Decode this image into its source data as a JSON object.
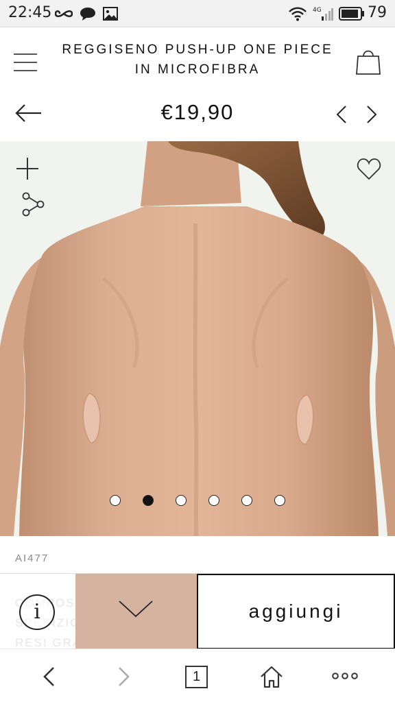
{
  "status_bar": {
    "time": "22:45",
    "battery": "79",
    "icons": [
      "infinity-icon",
      "chat-icon",
      "image-icon",
      "wifi-icon",
      "signal-4g-icon",
      "battery-icon"
    ]
  },
  "header": {
    "title_line1": "REGGISENO PUSH-UP ONE PIECE",
    "title_line2": "IN MICROFIBRA",
    "menu_icon": "hamburger-menu-icon",
    "bag_icon": "shopping-bag-icon"
  },
  "product": {
    "price": "€19,90",
    "sku": "AI477",
    "gallery": {
      "count": 6,
      "active_index": 1
    },
    "selected_color_hex": "#d6b3a0"
  },
  "actions": {
    "info_ghost_lines": [
      "COMPOSIZIONE",
      "SPEDIZIONE E",
      "RESI GRATUITI"
    ],
    "info_label": "i",
    "add_label": "aggiungi"
  },
  "browser_bar": {
    "tab_count": "1"
  },
  "colors": {
    "accent": "#111111",
    "hero_bg": "#f1f3ee",
    "skin": "#d6a88c"
  }
}
